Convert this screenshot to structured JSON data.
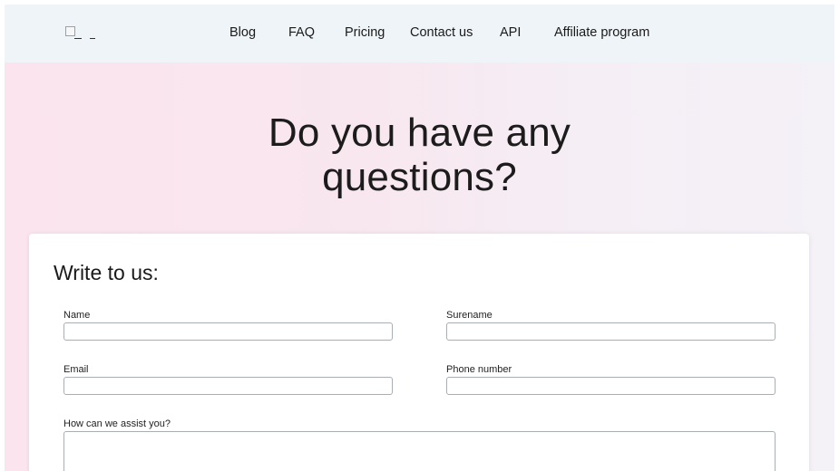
{
  "nav": {
    "links": [
      {
        "label": "Blog"
      },
      {
        "label": "FAQ"
      },
      {
        "label": "Pricing"
      },
      {
        "label": "Contact us"
      },
      {
        "label": "API"
      },
      {
        "label": "Affiliate program"
      }
    ]
  },
  "hero": {
    "title_line1": "Do you have any",
    "title_line2": "questions?"
  },
  "form": {
    "title": "Write to us:",
    "name_label": "Name",
    "name_value": "",
    "surname_label": "Surename",
    "surname_value": "",
    "email_label": "Email",
    "email_value": "",
    "phone_label": "Phone number",
    "phone_value": "",
    "assist_label": "How can we assist you?",
    "assist_value": ""
  },
  "colors": {
    "navbar_bg": "#eff4f8",
    "hero_bg_left": "#fbe4ee",
    "hero_bg_right": "#f4f1f7",
    "card_bg": "#ffffff"
  },
  "icons": {
    "logo": "broken-image-icon"
  }
}
